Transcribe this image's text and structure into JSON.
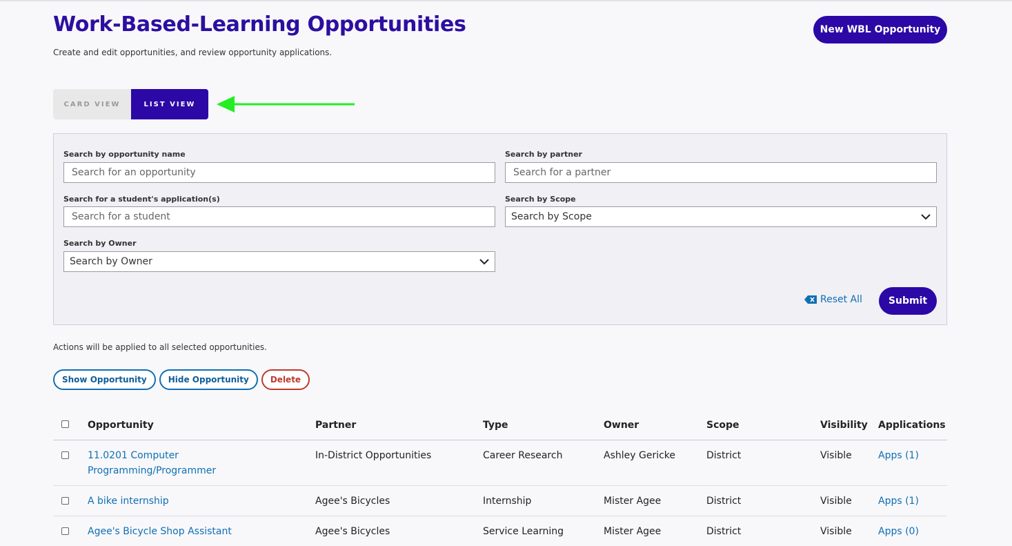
{
  "header": {
    "title": "Work-Based-Learning Opportunities",
    "subtitle": "Create and edit opportunities, and review opportunity applications.",
    "new_button": "New WBL Opportunity"
  },
  "view_toggle": {
    "card": "CARD VIEW",
    "list": "LIST VIEW",
    "active": "list"
  },
  "annotation": {
    "arrow_color": "#22ee22",
    "arrow_icon": "arrow-left-icon"
  },
  "search": {
    "opportunity_label": "Search by opportunity name",
    "opportunity_placeholder": "Search for an opportunity",
    "partner_label": "Search by partner",
    "partner_placeholder": "Search for a partner",
    "student_label": "Search for a student's application(s)",
    "student_placeholder": "Search for a student",
    "scope_label": "Search by Scope",
    "scope_value": "Search by Scope",
    "owner_label": "Search by Owner",
    "owner_value": "Search by Owner",
    "reset_label": "Reset All",
    "submit_label": "Submit"
  },
  "actions": {
    "note": "Actions will be applied to all selected opportunities.",
    "show": "Show Opportunity",
    "hide": "Hide Opportunity",
    "delete": "Delete"
  },
  "table": {
    "columns": [
      "Opportunity",
      "Partner",
      "Type",
      "Owner",
      "Scope",
      "Visibility",
      "Applications"
    ],
    "rows": [
      {
        "opportunity_line1": "11.0201 Computer",
        "opportunity_line2": "Programming/Programmer",
        "partner": "In-District Opportunities",
        "type": "Career Research",
        "owner": "Ashley Gericke",
        "scope": "District",
        "visibility": "Visible",
        "applications": "Apps (1)"
      },
      {
        "opportunity_line1": "A bike internship",
        "opportunity_line2": "",
        "partner": "Agee's Bicycles",
        "type": "Internship",
        "owner": "Mister Agee",
        "scope": "District",
        "visibility": "Visible",
        "applications": "Apps (1)"
      },
      {
        "opportunity_line1": "Agee's Bicycle Shop Assistant",
        "opportunity_line2": "",
        "partner": "Agee's Bicycles",
        "type": "Service Learning",
        "owner": "Mister Agee",
        "scope": "District",
        "visibility": "Visible",
        "applications": "Apps (0)"
      }
    ]
  }
}
